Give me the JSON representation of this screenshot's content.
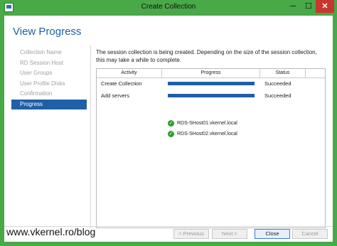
{
  "window": {
    "title": "Create Collection",
    "controls": {
      "minimize": "─",
      "maximize": "☐",
      "close": "✕"
    }
  },
  "page": {
    "heading": "View Progress"
  },
  "sidebar": {
    "items": [
      {
        "label": "Collection Name",
        "active": false
      },
      {
        "label": "RD Session Host",
        "active": false
      },
      {
        "label": "User Groups",
        "active": false
      },
      {
        "label": "User Profile Disks",
        "active": false
      },
      {
        "label": "Confirmation",
        "active": false
      },
      {
        "label": "Progress",
        "active": true
      }
    ]
  },
  "main": {
    "description": "The session collection is being created. Depending on the size of the session collection, this may take a while to complete.",
    "table": {
      "columns": [
        "Activity",
        "Progress",
        "Status"
      ],
      "rows": [
        {
          "activity": "Create Collection",
          "progress": 1.0,
          "status": "Succeeded"
        },
        {
          "activity": "Add servers",
          "progress": 1.0,
          "status": "Succeeded",
          "subitems": [
            {
              "label": "RDS-SHost01.vkernel.local",
              "icon": "success-check-icon"
            },
            {
              "label": "RDS-SHost02.vkernel.local",
              "icon": "success-check-icon"
            }
          ]
        }
      ]
    }
  },
  "footer": {
    "watermark": "www.vkernel.ro/blog",
    "buttons": {
      "previous": "< Previous",
      "next": "Next >",
      "close": "Close",
      "cancel": "Cancel"
    }
  },
  "colors": {
    "frame": "#49a848",
    "accent": "#1f5fa8",
    "success": "#2aa02a",
    "close_button": "#c7372f"
  }
}
